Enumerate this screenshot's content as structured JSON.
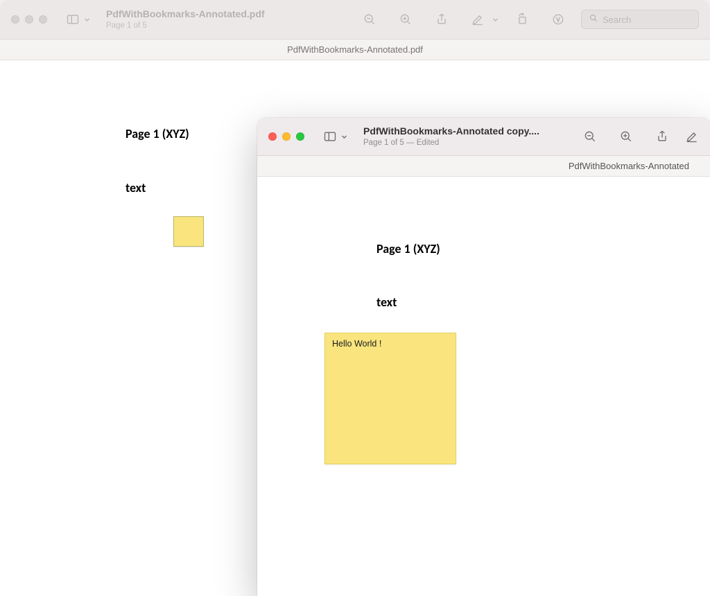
{
  "back": {
    "title": "PdfWithBookmarks-Annotated.pdf",
    "subtitle": "Page 1 of 5",
    "tab_label": "PdfWithBookmarks-Annotated.pdf",
    "search_placeholder": "Search",
    "page_heading": "Page 1 (XYZ)",
    "text_label": "text"
  },
  "front": {
    "title": "PdfWithBookmarks-Annotated copy....",
    "subtitle": "Page 1 of 5 — Edited",
    "tab_label": "PdfWithBookmarks-Annotated",
    "page_heading": "Page 1 (XYZ)",
    "text_label": "text",
    "note_text": "Hello World !"
  }
}
